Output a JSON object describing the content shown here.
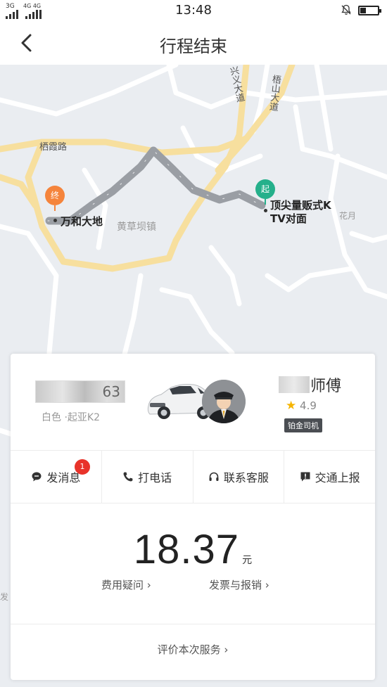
{
  "status_bar": {
    "signal1": "3G",
    "signal2": "4G 4G",
    "time": "13:48",
    "battery_level": 0.35
  },
  "nav": {
    "title": "行程结束"
  },
  "map": {
    "road_labels": [
      "栖霞路",
      "兴义大道",
      "梧山大道"
    ],
    "area_label": "黄草坝镇",
    "faint_labels": [
      "花月",
      "发"
    ],
    "start_pin": "起",
    "end_pin": "终",
    "start_location": "顶尖量贩式K\nTV对面",
    "end_location": "万和大地",
    "colors": {
      "start_pin": "#25b08b",
      "end_pin": "#f5843c",
      "route": "#9a9ea4"
    }
  },
  "driver": {
    "plate": "63",
    "car_description": "白色 ·起亚K2",
    "name": "师傅",
    "rating": "4.9",
    "badge": "铂金司机"
  },
  "actions": [
    {
      "label": "发消息",
      "icon": "message-icon",
      "unread": "1"
    },
    {
      "label": "打电话",
      "icon": "phone-icon"
    },
    {
      "label": "联系客服",
      "icon": "headset-icon"
    },
    {
      "label": "交通上报",
      "icon": "report-icon"
    }
  ],
  "fare": {
    "amount": "18.37",
    "unit": "元",
    "question_link": "费用疑问 ›",
    "invoice_link": "发票与报销 ›"
  },
  "rate": {
    "label": "评价本次服务 ›"
  }
}
